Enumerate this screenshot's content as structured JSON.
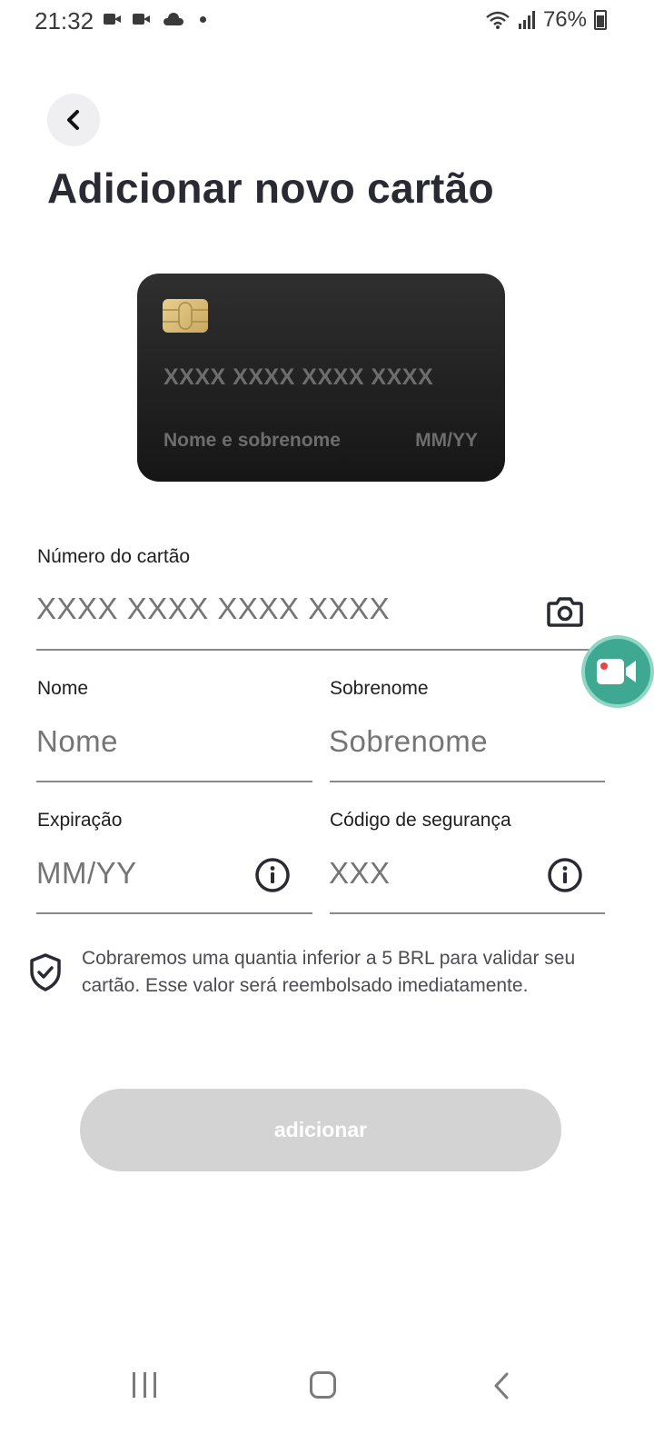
{
  "status_bar": {
    "time": "21:32",
    "battery": "76%",
    "icons": [
      "video-icon",
      "video-icon",
      "cloud-icon",
      "dot-icon",
      "wifi-icon",
      "signal-icon",
      "battery-icon"
    ]
  },
  "header": {
    "title": "Adicionar novo cartão"
  },
  "card_preview": {
    "number": "XXXX XXXX XXXX XXXX",
    "name": "Nome e sobrenome",
    "expiry": "MM/YY"
  },
  "form": {
    "card_number": {
      "label": "Número do cartão",
      "placeholder": "XXXX XXXX XXXX XXXX",
      "value": ""
    },
    "first_name": {
      "label": "Nome",
      "placeholder": "Nome",
      "value": ""
    },
    "last_name": {
      "label": "Sobrenome",
      "placeholder": "Sobrenome",
      "value": ""
    },
    "expiry": {
      "label": "Expiração",
      "placeholder": "MM/YY",
      "value": ""
    },
    "security_code": {
      "label": "Código de segurança",
      "placeholder": "XXX",
      "value": ""
    }
  },
  "notice": {
    "text": "Cobraremos uma quantia inferior a 5 BRL para validar seu cartão. Esse valor será reembolsado imediatamente."
  },
  "actions": {
    "add_label": "adicionar"
  },
  "colors": {
    "title": "#2a2a33",
    "card_bg": "#1c1c1c",
    "chip": "#d9bd78",
    "fab": "#3fa892",
    "button_disabled": "#d3d3d3"
  }
}
